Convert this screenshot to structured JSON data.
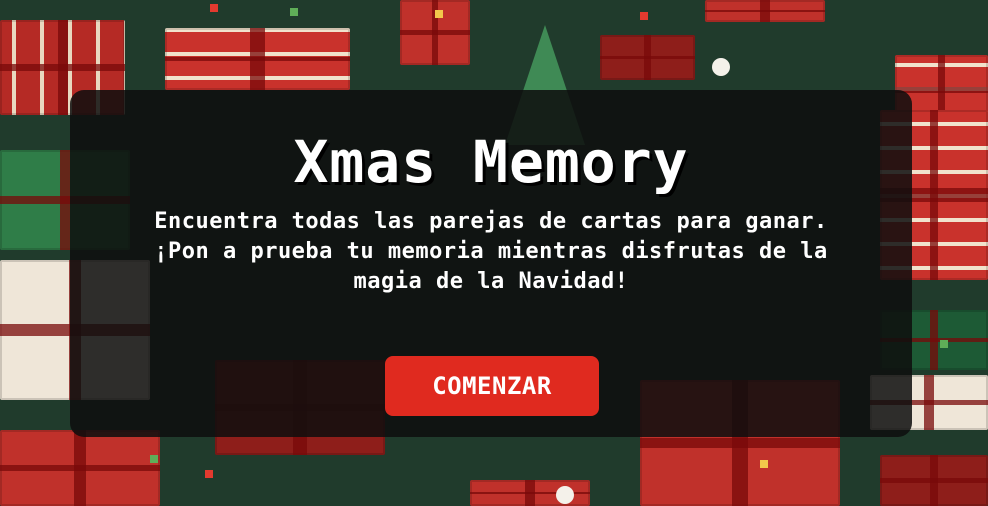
{
  "game": {
    "title": "Xmas Memory",
    "description": "Encuentra todas las parejas de cartas para ganar. ¡Pon a prueba tu memoria mientras disfrutas de la magia de la Navidad!",
    "start_label": "COMENZAR"
  },
  "colors": {
    "panel_bg": "#0e0e0e",
    "button_bg": "#e02a1f",
    "text": "#ffffff",
    "background": "#203b2c"
  }
}
